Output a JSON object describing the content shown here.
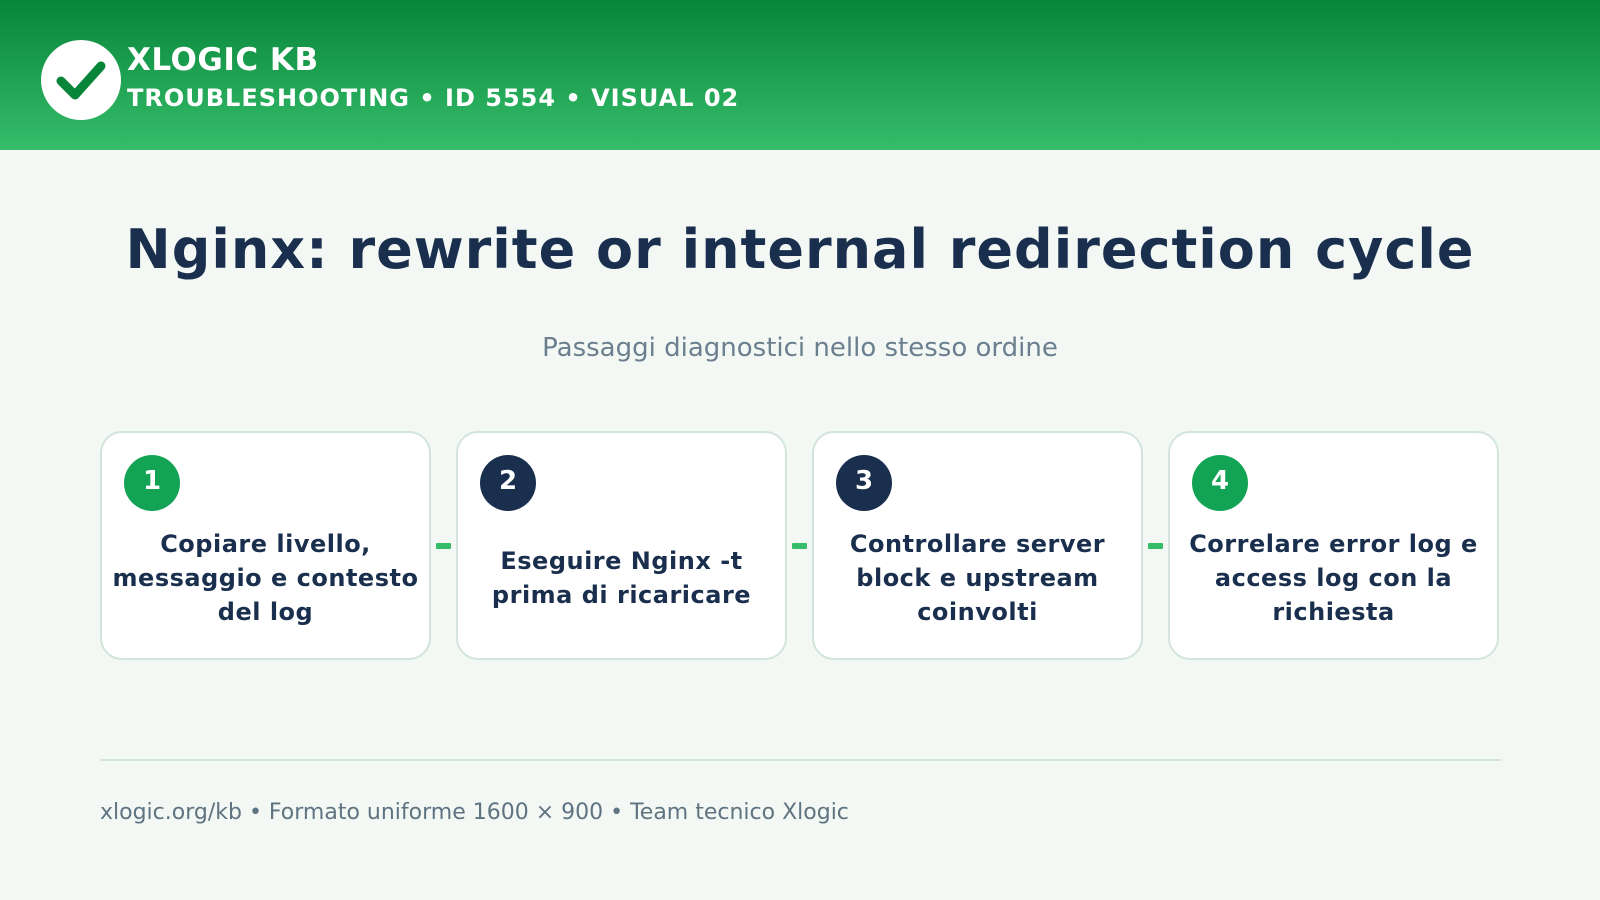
{
  "header": {
    "brand_name": "XLOGIC KB",
    "brand_subtitle": "TROUBLESHOOTING • ID 5554 • VISUAL 02",
    "logo_icon": "checkmark-icon",
    "gradient_top": "#078539",
    "gradient_bottom": "#35bd6a"
  },
  "main": {
    "title": "Nginx: rewrite or internal redirection cycle",
    "subtitle": "Passaggi diagnostici nello stesso ordine"
  },
  "steps": [
    {
      "number": "1",
      "text": "Copiare livello, messaggio e contesto del log",
      "badge_color": "#12a454"
    },
    {
      "number": "2",
      "text": "Eseguire Nginx -t prima di ricaricare",
      "badge_color": "#1a2f4d"
    },
    {
      "number": "3",
      "text": "Controllare server block e upstream coinvolti",
      "badge_color": "#1a2f4d"
    },
    {
      "number": "4",
      "text": "Correlare error log e access log con la richiesta",
      "badge_color": "#12a454"
    }
  ],
  "footer": {
    "text": "xlogic.org/kb • Formato uniforme 1600 × 900 • Team tecnico Xlogic"
  },
  "colors": {
    "background": "#f3f8f5",
    "title": "#1a2f4d",
    "accent": "#35bd6a",
    "card_border": "#d3e4dc"
  }
}
